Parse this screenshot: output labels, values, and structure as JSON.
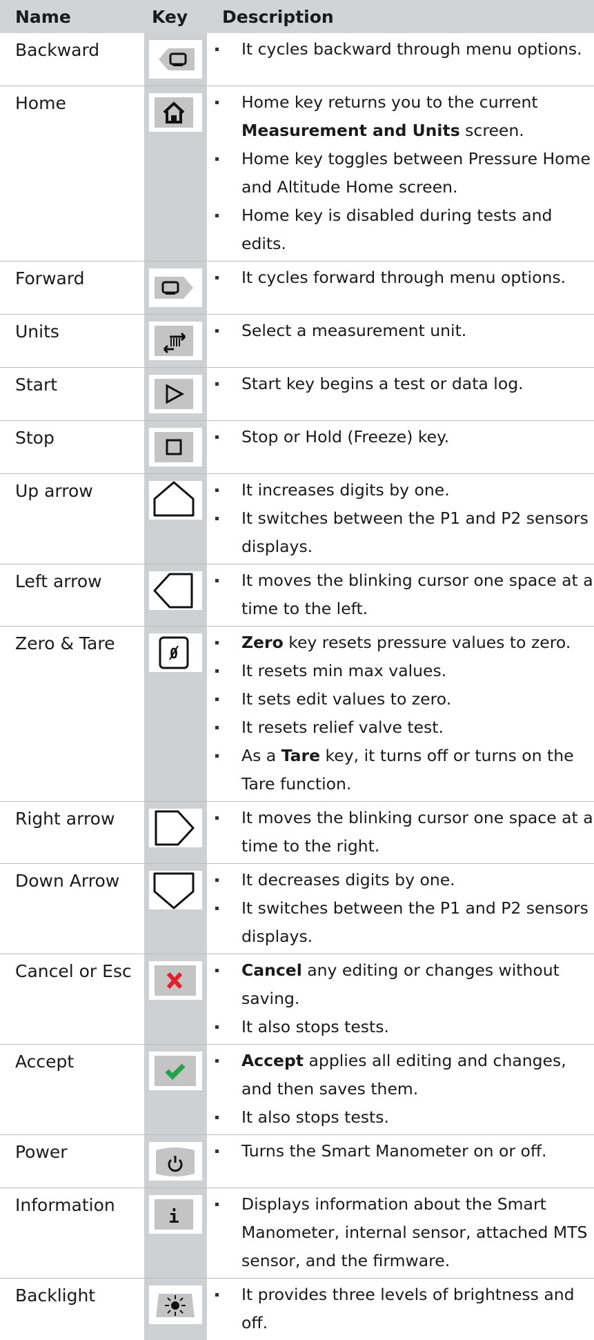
{
  "header": {
    "name": "Name",
    "key": "Key",
    "description": "Description"
  },
  "rows": [
    {
      "name": "Backward",
      "icon": "backward-icon",
      "items": [
        [
          "",
          "It cycles backward through menu options.",
          ""
        ]
      ]
    },
    {
      "name": "Home",
      "icon": "home-icon",
      "items": [
        [
          "",
          "Home key returns you to the current ",
          ""
        ],
        [
          "Measurement and Units",
          " screen.",
          "cont"
        ],
        [
          "",
          "Home key toggles between Pressure Home and Altitude Home screen.",
          ""
        ],
        [
          "",
          "Home key is disabled during tests and edits.",
          ""
        ]
      ]
    },
    {
      "name": "Forward",
      "icon": "forward-icon",
      "items": [
        [
          "",
          "It cycles forward through menu options.",
          ""
        ]
      ]
    },
    {
      "name": "Units",
      "icon": "units-icon",
      "items": [
        [
          "",
          "Select a measurement unit.",
          ""
        ]
      ]
    },
    {
      "name": "Start",
      "icon": "start-icon",
      "items": [
        [
          "",
          "Start key begins a test or data log.",
          ""
        ]
      ]
    },
    {
      "name": "Stop",
      "icon": "stop-icon",
      "items": [
        [
          "",
          "Stop or Hold (Freeze) key.",
          ""
        ]
      ]
    },
    {
      "name": "Up arrow",
      "icon": "up-arrow-icon",
      "items": [
        [
          "",
          "It increases digits by one.",
          ""
        ],
        [
          "",
          "It switches between the P1 and P2 sensors displays.",
          ""
        ]
      ]
    },
    {
      "name": "Left arrow",
      "icon": "left-arrow-icon",
      "items": [
        [
          "",
          "It moves the blinking cursor one space at a time to the left.",
          ""
        ]
      ]
    },
    {
      "name": "Zero & Tare",
      "icon": "zero-tare-icon",
      "items": [
        [
          "Zero",
          " key resets pressure values to zero.",
          ""
        ],
        [
          "",
          "It resets min max values.",
          ""
        ],
        [
          "",
          "It sets edit values to zero.",
          ""
        ],
        [
          "",
          "It resets relief valve test.",
          ""
        ],
        [
          "",
          "As a ",
          ""
        ]
      ]
    },
    {
      "name": "Right arrow",
      "icon": "right-arrow-icon",
      "items": [
        [
          "",
          "It moves the blinking cursor one space at a time to the right.",
          ""
        ]
      ]
    },
    {
      "name": "Down Arrow",
      "icon": "down-arrow-icon",
      "items": [
        [
          "",
          "It decreases digits by one.",
          ""
        ],
        [
          "",
          "It switches between the P1 and P2 sensors displays.",
          ""
        ]
      ]
    },
    {
      "name": "Cancel or Esc",
      "icon": "cancel-icon",
      "items": [
        [
          "Cancel",
          " any editing or changes without saving.",
          ""
        ],
        [
          "",
          "It also stops tests.",
          ""
        ]
      ]
    },
    {
      "name": "Accept",
      "icon": "accept-icon",
      "items": [
        [
          "Accept",
          " applies all editing and changes, and then saves them.",
          ""
        ],
        [
          "",
          "It also stops tests.",
          ""
        ]
      ]
    },
    {
      "name": "Power",
      "icon": "power-icon",
      "items": [
        [
          "",
          "Turns the Smart Manometer on or off.",
          ""
        ]
      ]
    },
    {
      "name": "Information",
      "icon": "information-icon",
      "items": [
        [
          "",
          "Displays information about the Smart Manometer, internal sensor, attached MTS sensor, and the firmware.",
          ""
        ]
      ]
    },
    {
      "name": "Backlight",
      "icon": "backlight-icon",
      "items": [
        [
          "",
          "It provides three levels of brightness and off.",
          ""
        ]
      ]
    }
  ],
  "zero_tare_extra": {
    "bold": "Tare",
    "rest": " key, it turns off or turns on the Tare function."
  },
  "colors": {
    "header_bg": "#d2d3d5",
    "key_column_bg": "#cfd0d2",
    "cancel_red": "#e0202e",
    "accept_green": "#22a24a"
  }
}
